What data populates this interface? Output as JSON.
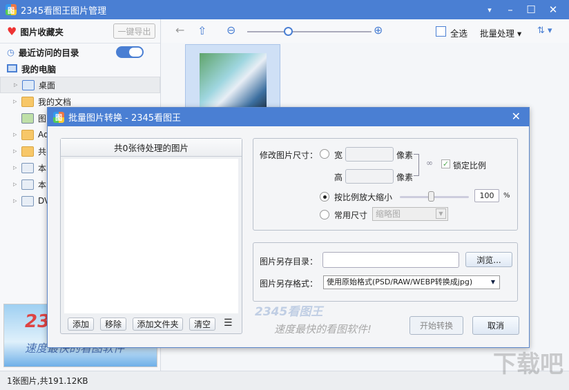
{
  "app": {
    "title": "2345看图王图片管理",
    "icon_text": "图"
  },
  "window_controls": {
    "menu": "▾",
    "minimize": "–",
    "maximize": "☐",
    "close": "✕"
  },
  "left": {
    "favorites_label": "图片收藏夹",
    "export_button": "一键导出",
    "recent_label": "最近访问的目录",
    "recent_toggle_on": true,
    "computer_label": "我的电脑",
    "tree": [
      "桌面",
      "我的文档",
      "图",
      "Adm",
      "共",
      "本",
      "本",
      "DVI"
    ],
    "banner": {
      "logo": "23",
      "slogan": "速度最快的看图软件"
    }
  },
  "toolbar": {
    "select_all": "全选",
    "batch": "批量处理 ▾",
    "sort": "⇅ ▾",
    "zoom_level": 0.32
  },
  "status": "1张图片,共191.12KB",
  "watermark": "下载吧",
  "dialog": {
    "title": "批量图片转换 - 2345看图王",
    "list_header": "共0张待处理的图片",
    "buttons": {
      "add": "添加",
      "remove": "移除",
      "add_folder": "添加文件夹",
      "clear": "清空"
    },
    "resize": {
      "label": "修改图片尺寸：",
      "width": "宽",
      "height": "高",
      "unit": "像素",
      "lock": "锁定比例",
      "lock_checked": true,
      "scale_label": "按比例放大缩小",
      "scale_value": "100",
      "percent": "%",
      "scale_selected": true,
      "preset_label": "常用尺寸",
      "preset_value": "缩略图"
    },
    "save": {
      "dir_label": "图片另存目录：",
      "dir_value": "",
      "browse": "浏览...",
      "format_label": "图片另存格式：",
      "format_value": "使用原始格式(PSD/RAW/WEBP转换成jpg)"
    },
    "brand": {
      "logo": "2345看图王",
      "slogan": "速度最快的看图软件!"
    },
    "start": "开始转换",
    "cancel": "取消"
  }
}
